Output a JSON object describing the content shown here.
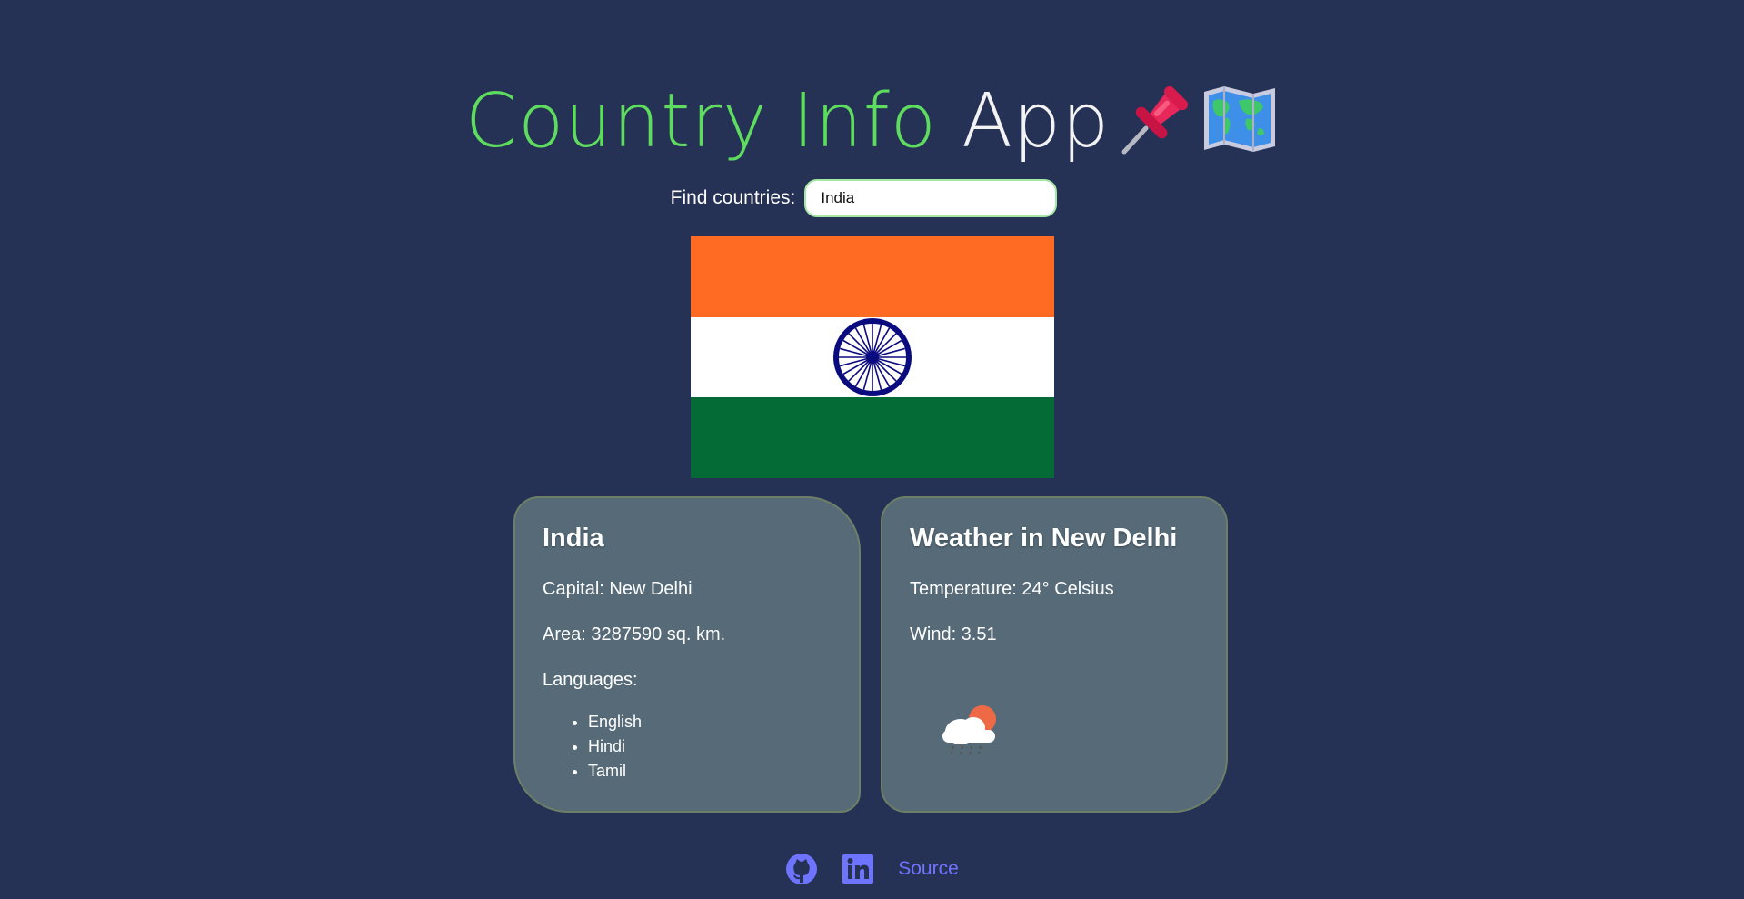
{
  "header": {
    "title_accent": "Country Info",
    "title_plain": "App",
    "emojis": [
      "pushpin-icon",
      "world-map-icon"
    ]
  },
  "search": {
    "label": "Find countries:",
    "value": "India",
    "placeholder": ""
  },
  "flag": {
    "country": "India",
    "colors": {
      "top": "#ff6b22",
      "middle": "#ffffff",
      "bottom": "#046b36",
      "chakra": "#0b0b80"
    }
  },
  "country_card": {
    "name": "India",
    "capital": "Capital: New Delhi",
    "area": "Area: 3287590 sq. km.",
    "languages_label": "Languages:",
    "languages": [
      "English",
      "Hindi",
      "Tamil"
    ]
  },
  "weather_card": {
    "title": "Weather in New Delhi",
    "temperature": "Temperature: 24° Celsius",
    "wind": "Wind: 3.51",
    "icon": "rain-cloud-sun-icon"
  },
  "footer": {
    "github_icon": "github-icon",
    "linkedin_icon": "linkedin-icon",
    "source_label": "Source",
    "link_color": "#6f74ff"
  },
  "colors": {
    "background": "#263156",
    "accent": "#5ddc5d",
    "card_bg": "#566a78"
  }
}
